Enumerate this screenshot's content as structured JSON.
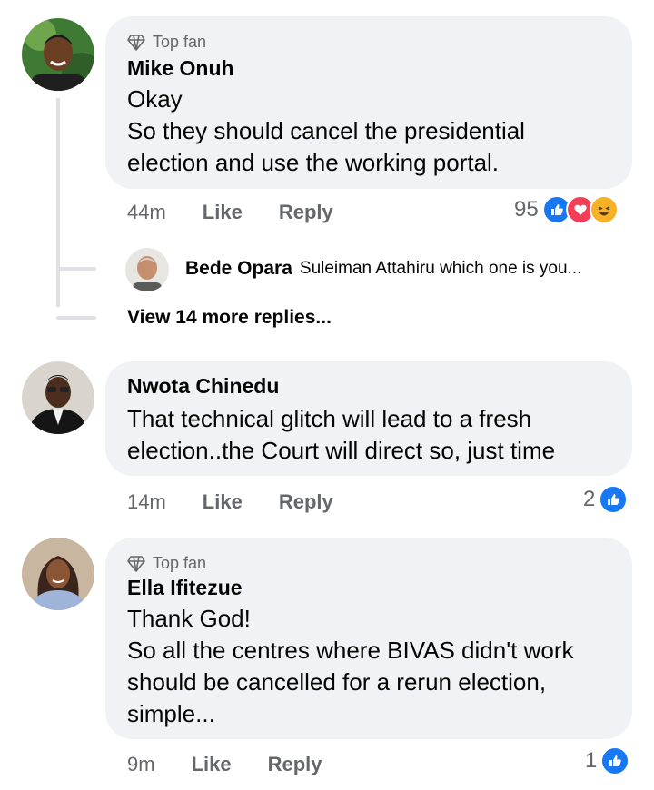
{
  "comments": [
    {
      "badge": "Top fan",
      "author": "Mike Onuh",
      "lines": [
        "Okay",
        "So they should cancel the presidential",
        "election and use the working portal."
      ],
      "time": "44m",
      "like_label": "Like",
      "reply_label": "Reply",
      "reaction_count": "95",
      "reactions": [
        "like-icon",
        "love-icon",
        "haha-icon"
      ]
    },
    {
      "author": "Nwota Chinedu",
      "lines": [
        "That technical glitch will lead to a fresh",
        "election..the Court will direct so, just time"
      ],
      "time": "14m",
      "like_label": "Like",
      "reply_label": "Reply",
      "reaction_count": "2",
      "reactions": [
        "like-icon"
      ]
    },
    {
      "badge": "Top fan",
      "author": "Ella Ifitezue",
      "lines": [
        "Thank God!",
        "So all the centres where BIVAS didn't work",
        "should be cancelled for a rerun election,",
        "simple..."
      ],
      "time": "9m",
      "like_label": "Like",
      "reply_label": "Reply",
      "reaction_count": "1",
      "reactions": [
        "like-icon"
      ]
    }
  ],
  "reply_preview": {
    "author": "Bede Opara",
    "text": "Suleiman Attahiru which one is you..."
  },
  "view_more": "View 14 more replies...",
  "colors": {
    "bubble": "#f0f2f5",
    "secondary_text": "#65676b",
    "like_blue": "#1877f2",
    "love_red": "#f33e58",
    "haha_yellow": "#f7b125"
  }
}
